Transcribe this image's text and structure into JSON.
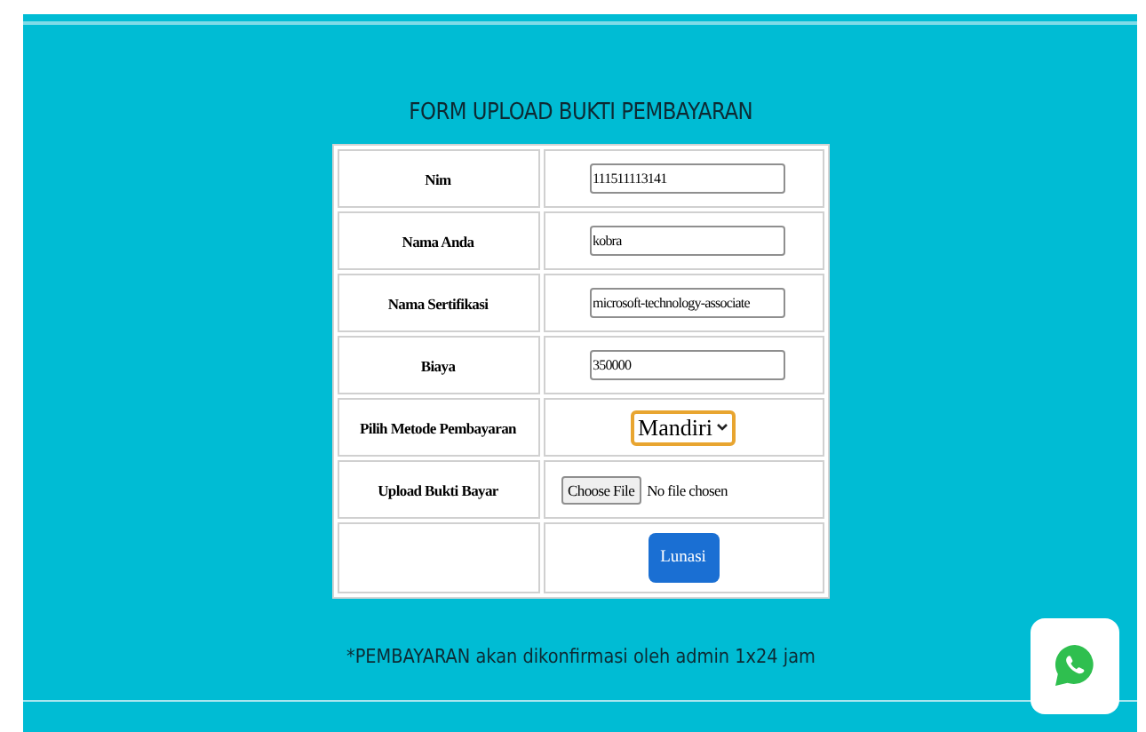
{
  "form": {
    "title": "FORM UPLOAD BUKTI PEMBAYARAN",
    "rows": [
      {
        "kind": "text",
        "label": "Nim",
        "value": "111511113141"
      },
      {
        "kind": "text",
        "label": "Nama Anda",
        "value": "kobra"
      },
      {
        "kind": "text",
        "label": "Nama Sertifikasi",
        "value": "microsoft-technology-associate"
      },
      {
        "kind": "text",
        "label": "Biaya",
        "value": "350000"
      },
      {
        "kind": "select",
        "label": "Pilih Metode Pembayaran",
        "value": "Mandiri"
      },
      {
        "kind": "file",
        "label": "Upload Bukti Bayar",
        "button": "Choose File",
        "value": "No file chosen"
      },
      {
        "kind": "submit",
        "button": "Lunasi"
      }
    ]
  },
  "note": "*PEMBAYARAN akan dikonfirmasi oleh admin 1x24 jam"
}
